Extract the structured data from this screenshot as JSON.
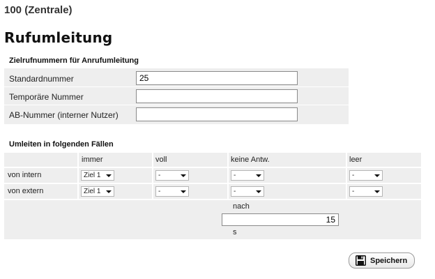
{
  "extension_title": "100 (Zentrale)",
  "page_title": "Rufumleitung",
  "targets": {
    "title": "Zielrufnummern für Anrufumleitung",
    "rows": [
      {
        "label": "Standardnummer",
        "value": "25"
      },
      {
        "label": "Temporäre Nummer",
        "value": ""
      },
      {
        "label": "AB-Nummer (interner Nutzer)",
        "value": ""
      }
    ]
  },
  "forwarding": {
    "title": "Umleiten in folgenden Fällen",
    "columns": [
      "immer",
      "voll",
      "keine Antw.",
      "leer"
    ],
    "rows": [
      {
        "label": "von intern",
        "values": [
          "Ziel 1",
          "-",
          "-",
          "-"
        ]
      },
      {
        "label": "von extern",
        "values": [
          "Ziel 1",
          "-",
          "-",
          "-"
        ]
      }
    ],
    "delay": {
      "label": "nach",
      "value": "15",
      "unit": "s"
    }
  },
  "save_label": "Speichern",
  "icons": {
    "save": "floppy-disk-icon"
  }
}
